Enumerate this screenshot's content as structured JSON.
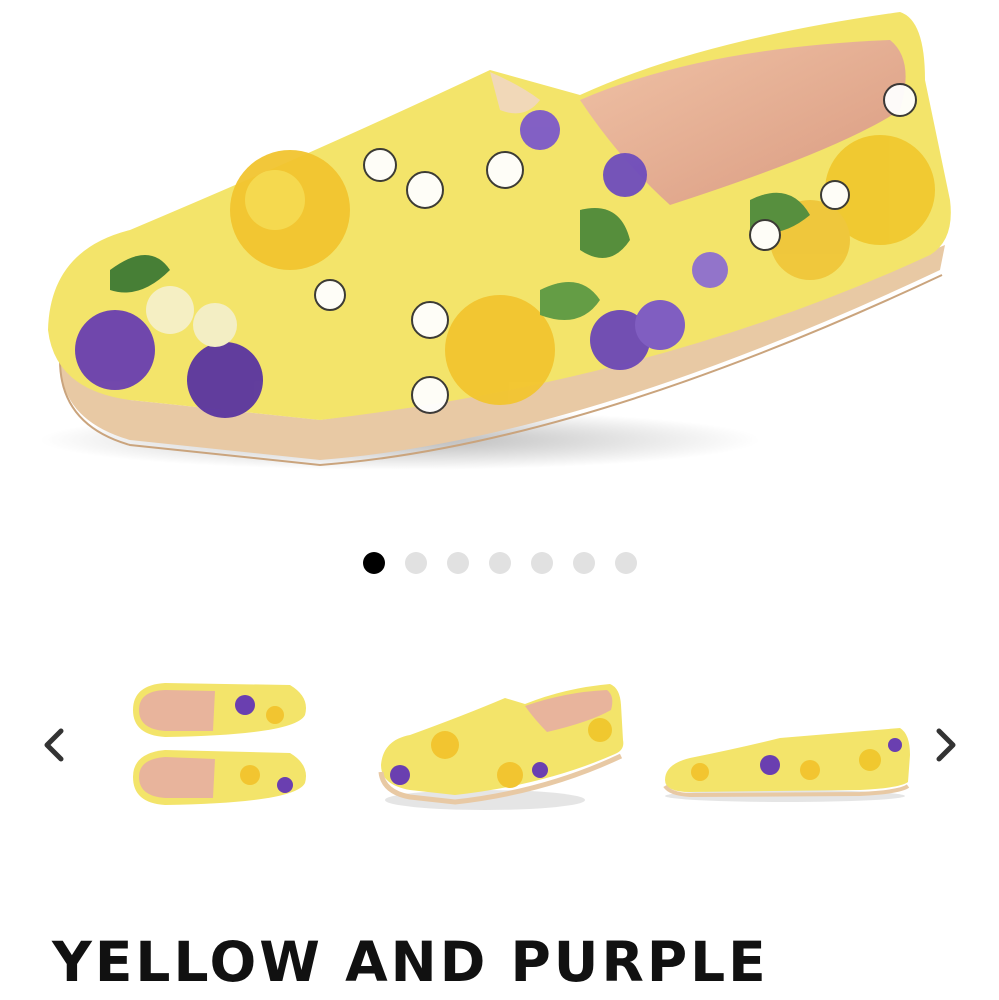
{
  "product": {
    "title": "YELLOW AND PURPLE"
  },
  "gallery": {
    "slide_count": 7,
    "active_index": 0,
    "main_image_icon": "floral-slip-on-shoe-image",
    "thumbnails": [
      {
        "icon": "shoe-pair-top-view-thumbnail"
      },
      {
        "icon": "shoe-angle-view-thumbnail"
      },
      {
        "icon": "shoe-side-view-thumbnail"
      }
    ],
    "prev_icon": "chevron-left-icon",
    "next_icon": "chevron-right-icon"
  },
  "colors": {
    "canvas_yellow": "#f3e46a",
    "flower_purple": "#6a3fb0",
    "sole_tan": "#e8c9a4",
    "lining_pink": "#e8b49c",
    "dot_active": "#000000",
    "dot_inactive": "#e1e1e1"
  }
}
